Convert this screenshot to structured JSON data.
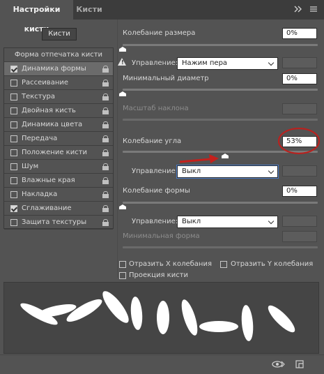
{
  "tabs": {
    "active_label": "Настройки кисти",
    "inactive_label": "Кисти",
    "expand_icon": "double-chevron-right-icon",
    "menu_icon": "hamburger-menu-icon"
  },
  "brushes_button": "Кисти",
  "sidebar": {
    "header": "Форма отпечатка кисти",
    "items": [
      {
        "label": "Динамика формы",
        "checked": true,
        "selected": true
      },
      {
        "label": "Рассеивание",
        "checked": false
      },
      {
        "label": "Текстура",
        "checked": false
      },
      {
        "label": "Двойная кисть",
        "checked": false
      },
      {
        "label": "Динамика цвета",
        "checked": false
      },
      {
        "label": "Передача",
        "checked": false
      },
      {
        "label": "Положение кисти",
        "checked": false
      },
      {
        "label": "Шум",
        "checked": false
      },
      {
        "label": "Влажные края",
        "checked": false
      },
      {
        "label": "Накладка",
        "checked": false
      },
      {
        "label": "Сглаживание",
        "checked": true
      },
      {
        "label": "Защита текстуры",
        "checked": false
      }
    ]
  },
  "settings": {
    "size_jitter_label": "Колебание размера",
    "size_jitter_value": "0%",
    "size_control_label": "Управление:",
    "size_control_value": "Нажим пера",
    "min_diameter_label": "Минимальный диаметр",
    "min_diameter_value": "0%",
    "tilt_scale_label": "Масштаб наклона",
    "angle_jitter_label": "Колебание угла",
    "angle_jitter_value": "53%",
    "angle_control_label": "Управление:",
    "angle_control_value": "Выкл",
    "roundness_jitter_label": "Колебание формы",
    "roundness_jitter_value": "0%",
    "roundness_control_label": "Управление:",
    "roundness_control_value": "Выкл",
    "min_roundness_label": "Минимальная форма",
    "flip_x_label": "Отразить X колебания",
    "flip_y_label": "Отразить Y колебания",
    "brush_projection_label": "Проекция кисти"
  },
  "bottom_icons": [
    "eye-cycle-icon",
    "new-preset-icon"
  ],
  "annotation_colors": {
    "circle": "#b8221f",
    "arrow": "#c4201c"
  }
}
